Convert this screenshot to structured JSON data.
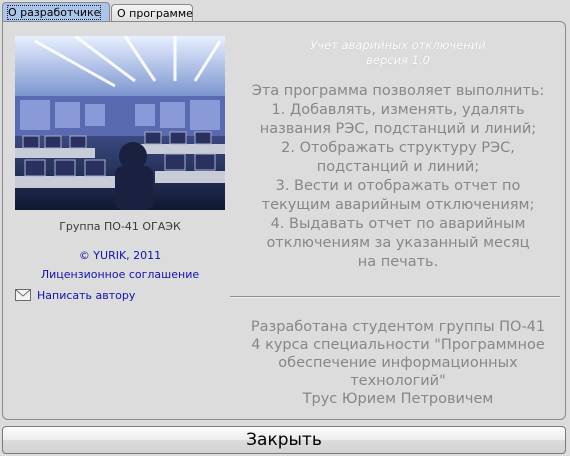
{
  "tabs": [
    {
      "label": "О разработчике",
      "active": true
    },
    {
      "label": "О программе",
      "active": false
    }
  ],
  "left": {
    "photo_description": "control-room-photo",
    "caption": "Группа ПО-41 ОГАЭК",
    "copyright": "© YURIK, 2011",
    "license_link": "Лицензионное соглашение",
    "mail_link": "Написать автору"
  },
  "right": {
    "title_lines": [
      "Учет аварийных отключений",
      "версия 1.0"
    ],
    "description_lines": [
      "Эта программа позволяет выполнить:",
      "1. Добавлять, изменять, удалять",
      "названия РЭС, подстанций и линий;",
      "2. Отображать структуру РЭС,",
      "подстанций и линий;",
      "3. Вести и отображать отчет по",
      "текущим аварийным отключениям;",
      "4. Выдавать отчет по аварийным",
      "отключениям за указанный месяц",
      "на печать."
    ],
    "author_lines": [
      "Разработана студентом группы ПО-41",
      "4 курса специальности \"Программное",
      "обеспечение информационных",
      "технологий\"",
      "Трус Юрием Петровичем"
    ]
  },
  "buttons": {
    "close": "Закрыть"
  },
  "colors": {
    "tab_active": "#aac4ea",
    "link": "#1212b0",
    "text_gray": "#878787"
  }
}
